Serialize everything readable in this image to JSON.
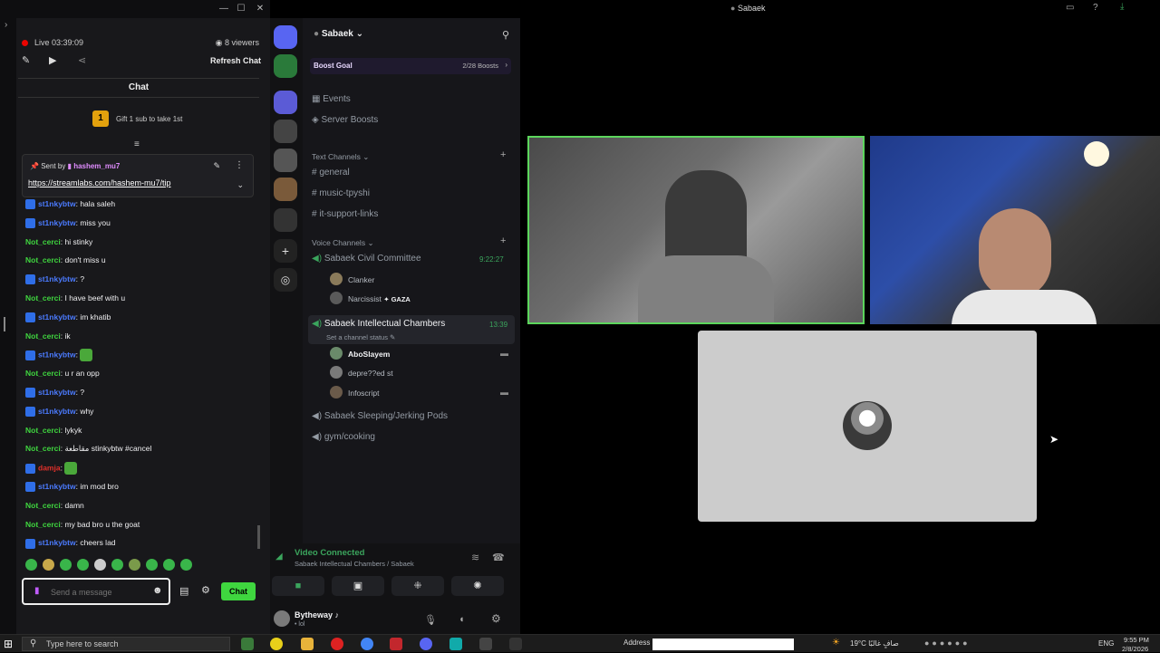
{
  "chat": {
    "live_status": "Live 03:39:09",
    "viewers": "8 viewers",
    "refresh_label": "Refresh Chat",
    "header": "Chat",
    "gift_count": "1",
    "gift_text": "Gift 1 sub to take 1st",
    "pinned": {
      "sent_by": "Sent by",
      "user": "hashem_mu7",
      "link": "https://streamlabs.com/hashem-mu7/tip"
    },
    "messages": [
      {
        "badge": true,
        "user": "st1nkybtw",
        "text": "hala saleh",
        "color": "#4b7bff"
      },
      {
        "badge": true,
        "user": "st1nkybtw",
        "text": "miss you",
        "color": "#4b7bff"
      },
      {
        "badge": false,
        "user": "Not_cerci",
        "text": "hi stinky",
        "color": "#3fd63f"
      },
      {
        "badge": false,
        "user": "Not_cerci",
        "text": "don't miss u",
        "color": "#3fd63f"
      },
      {
        "badge": true,
        "user": "st1nkybtw",
        "text": "?",
        "color": "#4b7bff"
      },
      {
        "badge": false,
        "user": "Not_cerci",
        "text": "I have beef with u",
        "color": "#3fd63f"
      },
      {
        "badge": true,
        "user": "st1nkybtw",
        "text": "im khatib",
        "color": "#4b7bff"
      },
      {
        "badge": false,
        "user": "Not_cerci",
        "text": "ik",
        "color": "#3fd63f"
      },
      {
        "badge": true,
        "user": "st1nkybtw",
        "text": "",
        "color": "#4b7bff",
        "emote": true
      },
      {
        "badge": false,
        "user": "Not_cerci",
        "text": "u r an opp",
        "color": "#3fd63f"
      },
      {
        "badge": true,
        "user": "st1nkybtw",
        "text": "?",
        "color": "#4b7bff"
      },
      {
        "badge": true,
        "user": "st1nkybtw",
        "text": "why",
        "color": "#4b7bff"
      },
      {
        "badge": false,
        "user": "Not_cerci",
        "text": "lykyk",
        "color": "#3fd63f"
      },
      {
        "badge": false,
        "user": "Not_cerci",
        "text": "مقاطعة stinkybtw #cancel",
        "color": "#3fd63f"
      },
      {
        "badge": true,
        "user": "damja",
        "text": "",
        "color": "#e0302a",
        "emote": true
      },
      {
        "badge": true,
        "user": "st1nkybtw",
        "text": "im mod bro",
        "color": "#4b7bff"
      },
      {
        "badge": false,
        "user": "Not_cerci",
        "text": "damn",
        "color": "#3fd63f"
      },
      {
        "badge": false,
        "user": "Not_cerci",
        "text": "my bad bro u the goat",
        "color": "#3fd63f"
      },
      {
        "badge": true,
        "user": "st1nkybtw",
        "text": "cheers lad",
        "color": "#4b7bff"
      }
    ],
    "input_placeholder": "Send a message",
    "send_label": "Chat"
  },
  "discord": {
    "server_name": "Sabaek",
    "boost_goal": "Boost Goal",
    "boost_count": "2/28 Boosts",
    "events": "Events",
    "server_boosts": "Server Boosts",
    "text_category": "Text Channels",
    "text_channels": [
      "general",
      "music-tpyshi",
      "it-support-links"
    ],
    "voice_category": "Voice Channels",
    "vc1": {
      "name": "Sabaek Civil Committee",
      "time": "9:22:27",
      "users": [
        "Clanker",
        "Narcissist"
      ],
      "tag": "GAZA"
    },
    "vc2": {
      "name": "Sabaek Intellectual Chambers",
      "time": "13:39",
      "status": "Set a channel status",
      "users": [
        "AboSlayem",
        "depre??ed st",
        "Infoscript"
      ]
    },
    "vc3": "Sabaek Sleeping/Jerking Pods",
    "vc4": "gym/cooking",
    "connection": "Video Connected",
    "connection_sub": "Sabaek Intellectual Chambers / Sabaek",
    "username": "Bytheway",
    "user_status": "• lol"
  },
  "topbar": {
    "title": "Sabaek"
  },
  "taskbar": {
    "search_placeholder": "Type here to search",
    "address_label": "Address",
    "weather": "19°C صافٍ غالبًا",
    "lang": "ENG",
    "time": "9:55 PM",
    "date": "2/8/2026"
  }
}
